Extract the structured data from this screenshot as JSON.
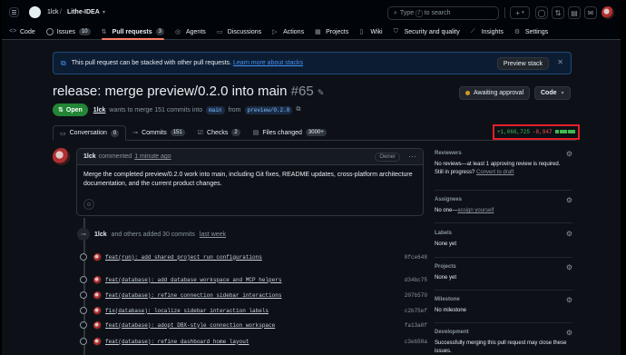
{
  "header": {
    "owner": "1lck",
    "repo": "Lithe-IDEA",
    "search_placeholder": "Type / to search",
    "search_key": "/"
  },
  "repo_nav": {
    "tabs": [
      {
        "label": "Code",
        "icon": "code-icon"
      },
      {
        "label": "Issues",
        "count": "10",
        "icon": "issue-icon"
      },
      {
        "label": "Pull requests",
        "count": "3",
        "icon": "pr-icon",
        "active": true
      },
      {
        "label": "Agents",
        "icon": "agent-icon"
      },
      {
        "label": "Discussions",
        "icon": "discussion-icon"
      },
      {
        "label": "Actions",
        "icon": "play-icon"
      },
      {
        "label": "Projects",
        "icon": "table-icon"
      },
      {
        "label": "Wiki",
        "icon": "book-icon"
      },
      {
        "label": "Security and quality",
        "icon": "shield-icon"
      },
      {
        "label": "Insights",
        "icon": "graph-icon"
      },
      {
        "label": "Settings",
        "icon": "gear-icon"
      }
    ]
  },
  "banner": {
    "text": "This pull request can be stacked with other pull requests.",
    "link": "Learn more about stacks",
    "button": "Preview stack"
  },
  "pr": {
    "title": "release: merge preview/0.2.0 into main",
    "number": "#65",
    "status": "Open",
    "author": "1lck",
    "meta_1": "wants to merge 151 commits into",
    "base": "main",
    "meta_2": "from",
    "head": "preview/0.2.0",
    "awaiting": "Awaiting approval",
    "code_button": "Code"
  },
  "pr_tabs": [
    {
      "label": "Conversation",
      "count": "0"
    },
    {
      "label": "Commits",
      "count": "151"
    },
    {
      "label": "Checks",
      "count": "2"
    },
    {
      "label": "Files changed",
      "count": "3000+"
    }
  ],
  "diffstat": {
    "additions": "+1,066,725",
    "deletions": "-8,947",
    "colors": {
      "add": "#3fb950",
      "del": "#f85149",
      "neutral": "#30363d"
    }
  },
  "comment": {
    "author": "1lck",
    "action": "commented",
    "time": "1 minute ago",
    "badge": "Owner",
    "body": "Merge the completed preview/0.2.0 work into main, including Git fixes, README updates, cross-platform architecture documentation, and the current product changes."
  },
  "timeline": {
    "author": "1lck",
    "summary": "and others added 30 commits",
    "when": "last week",
    "commits": [
      {
        "msg": "feat(run): add shared project run configurations",
        "sha": "0fce648"
      },
      {
        "msg": "feat(database): add database workspace and MCP helpers",
        "sha": "d34bc75"
      },
      {
        "msg": "feat(database): refine connection sidebar interactions",
        "sha": "207b570"
      },
      {
        "msg": "fix(database): localize sidebar interaction labels",
        "sha": "c2b75ef"
      },
      {
        "msg": "feat(database): adopt DBX-style connection workspace",
        "sha": "fa13a0f"
      },
      {
        "msg": "feat(database): refine dashboard home layout",
        "sha": "c3eb50a"
      }
    ]
  },
  "sidebar": {
    "reviewers_title": "Reviewers",
    "reviewers_text": "No reviews—at least 1 approving review is required.",
    "reviewers_text2": "Still in progress?",
    "reviewers_link": "Convert to draft",
    "assignees_title": "Assignees",
    "assignees_text": "No one—",
    "assignees_link": "assign yourself",
    "labels_title": "Labels",
    "labels_text": "None yet",
    "projects_title": "Projects",
    "projects_text": "None yet",
    "milestone_title": "Milestone",
    "milestone_text": "No milestone",
    "development_title": "Development",
    "development_text": "Successfully merging this pull request may close these issues."
  }
}
